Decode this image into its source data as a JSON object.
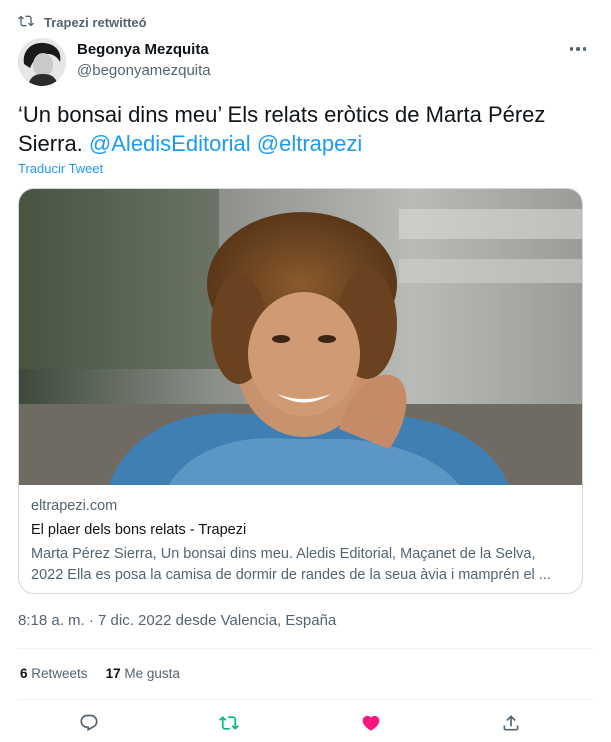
{
  "retweet_header": {
    "label": "Trapezi retwitteó",
    "icon": "retweet-icon"
  },
  "author": {
    "name": "Begonya Mezquita",
    "handle": "@begonyamezquita"
  },
  "tweet": {
    "text": "‘Un bonsai dins meu’ Els relats eròtics de Marta Pérez Sierra.",
    "mentions": [
      "@AledisEditorial",
      "@eltrapezi"
    ],
    "translate_label": "Traducir Tweet"
  },
  "card": {
    "domain": "eltrapezi.com",
    "title": "El plaer dels bons relats - Trapezi",
    "description": "Marta Pérez Sierra, Un bonsai dins meu. Aledis Editorial, Maçanet de la Selva, 2022 Ella es posa la camisa de dormir de randes de la seua àvia i mamprén el ..."
  },
  "meta": {
    "timestamp": "8:18 a. m. · 7 dic. 2022 desde Valencia, España"
  },
  "stats": {
    "retweets_count": "6",
    "retweets_label": "Retweets",
    "likes_count": "17",
    "likes_label": "Me gusta"
  },
  "actions": [
    {
      "name": "reply-icon"
    },
    {
      "name": "retweet-icon",
      "color": "#00ba7c"
    },
    {
      "name": "like-icon",
      "color": "#f91880"
    },
    {
      "name": "share-icon"
    }
  ],
  "colors": {
    "accent": "#1d9bf0",
    "text": "#0f1419",
    "muted": "#536471",
    "retweet": "#00ba7c",
    "like": "#f91880"
  }
}
